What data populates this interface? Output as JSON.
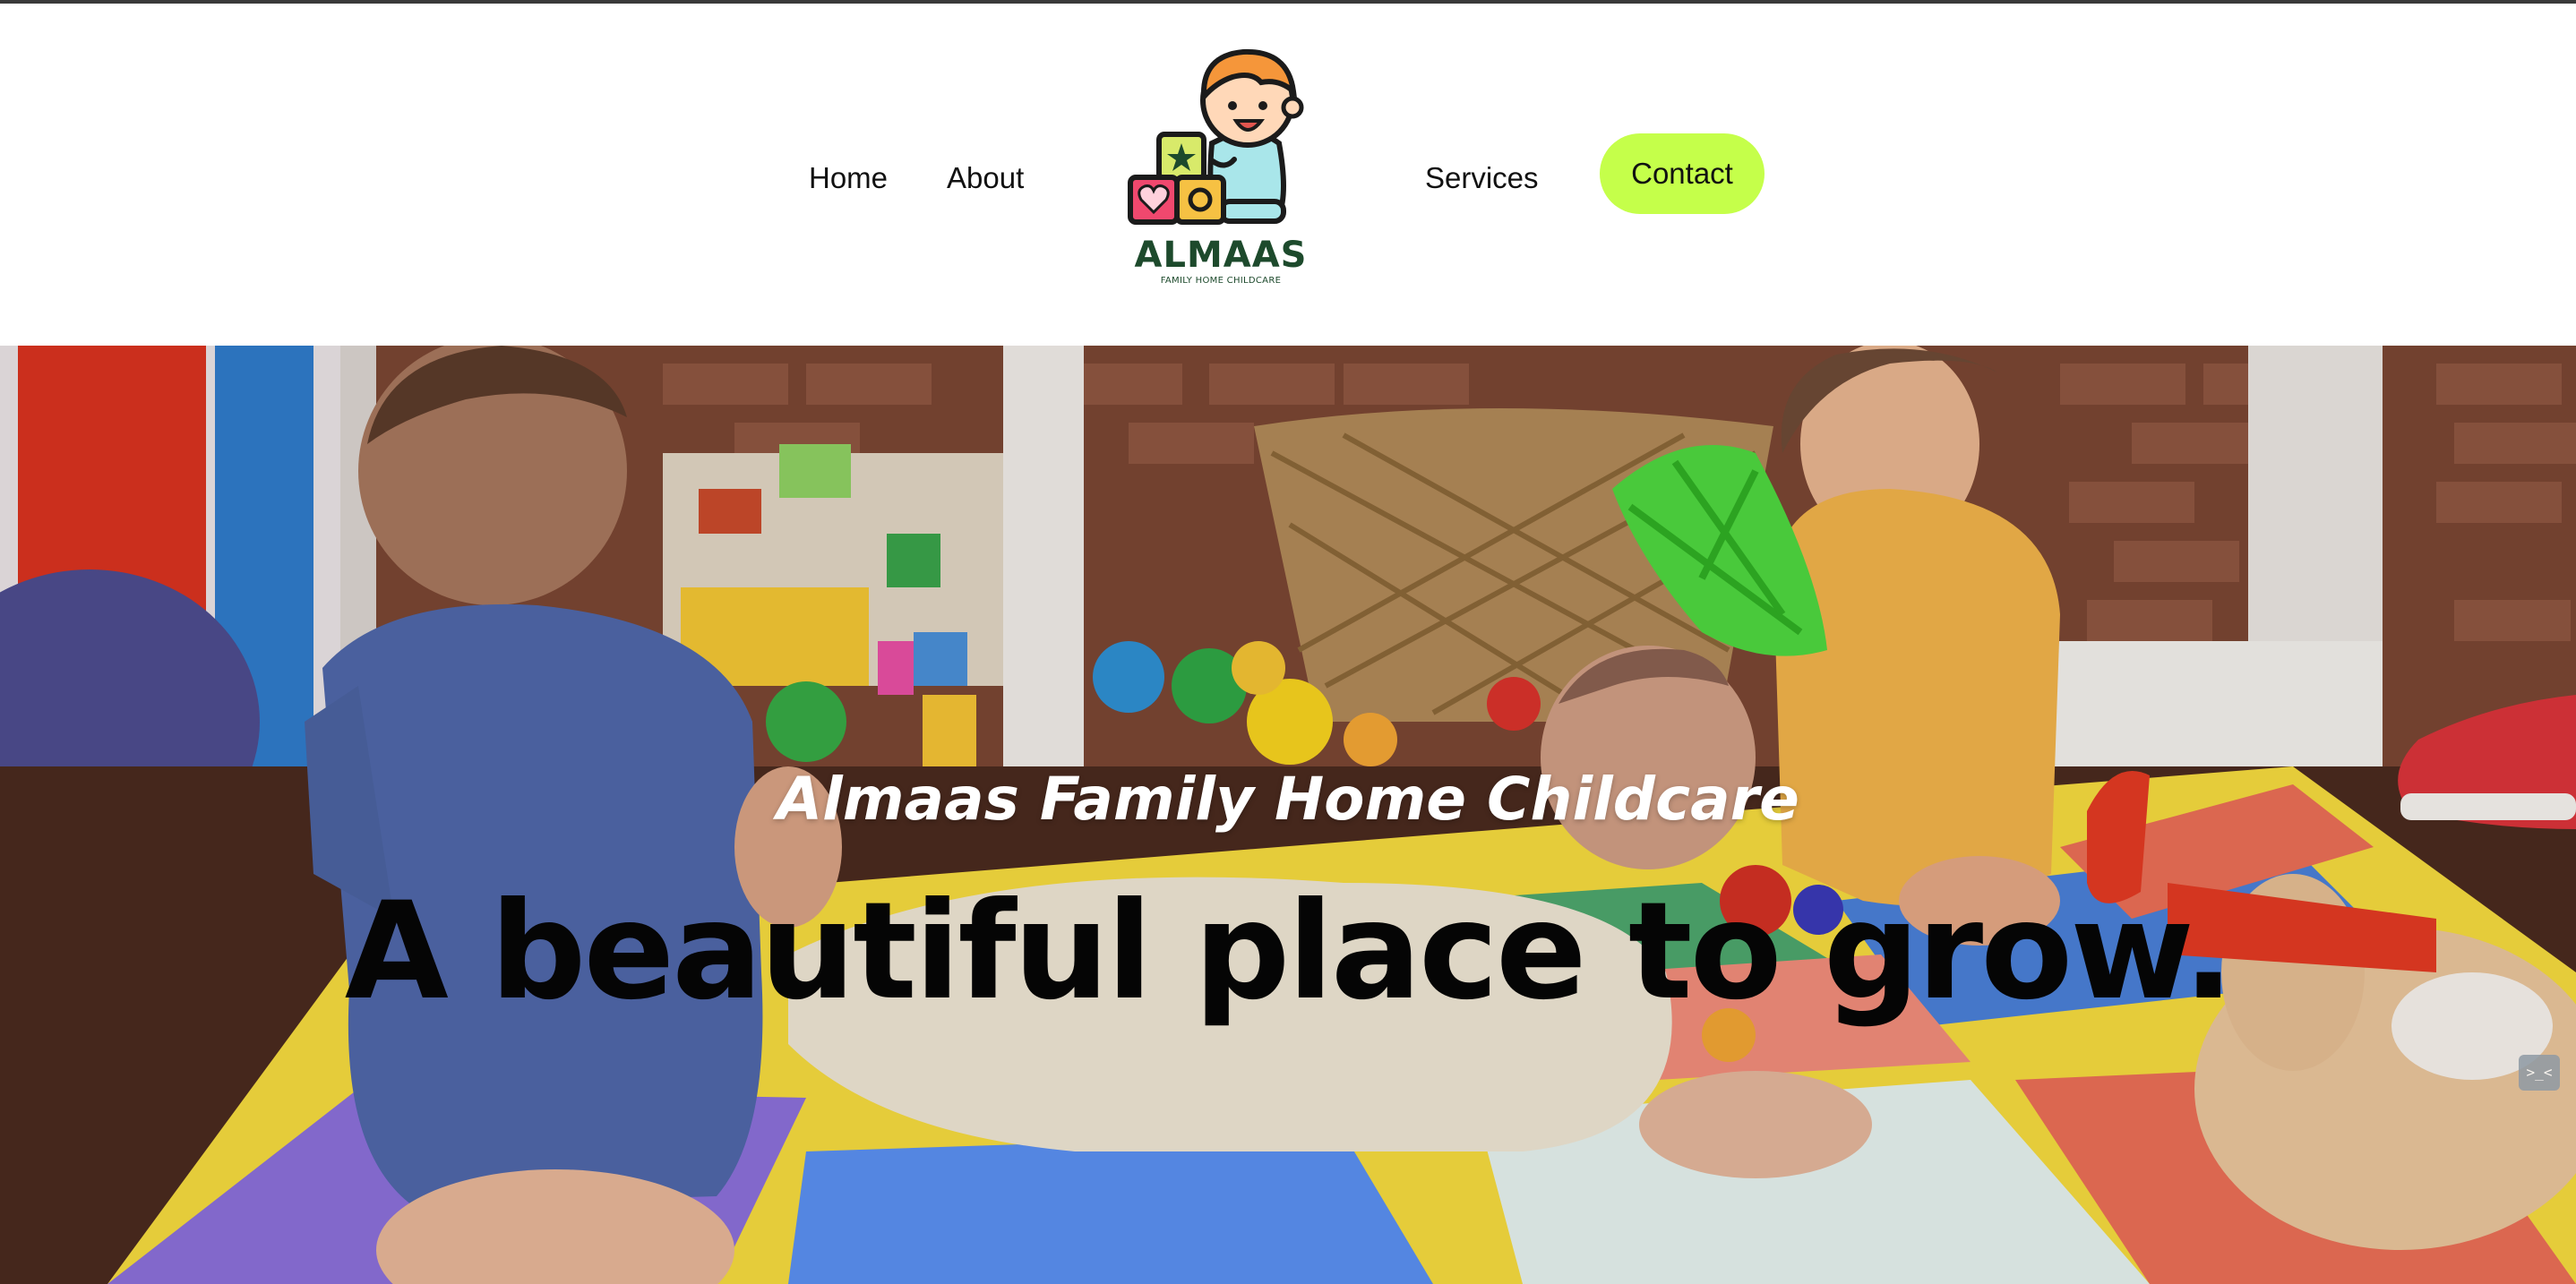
{
  "nav": {
    "home": "Home",
    "about": "About",
    "services": "Services",
    "contact": "Contact"
  },
  "logo": {
    "wordmark": "ALMAAS",
    "tagline": "FAMILY HOME CHILDCARE",
    "icon": "child-with-blocks-icon"
  },
  "hero": {
    "subtitle": "Almaas Family Home Childcare",
    "title": "A beautiful place to grow.",
    "image": "babies-playing-on-foam-mat-photo"
  },
  "widget": {
    "icon": "code-icon",
    "symbol": ">_<"
  },
  "colors": {
    "contact_button": "#c5ff4a",
    "logo_text": "#1d4a2c",
    "hero_title": "#050505",
    "hero_subtitle": "#ffffff"
  }
}
